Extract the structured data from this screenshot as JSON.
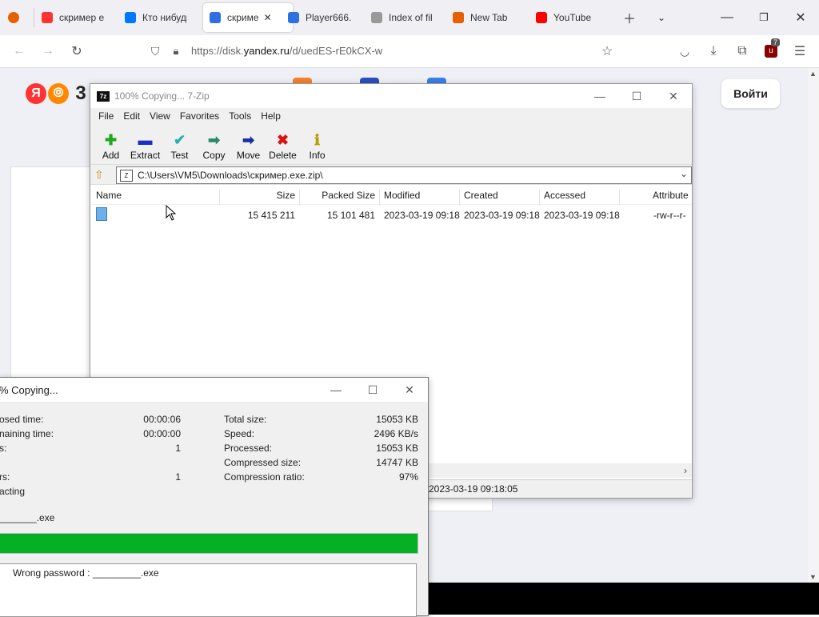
{
  "browser": {
    "tabs": [
      {
        "label": "скример е",
        "icon": "yandex-icon",
        "color": "#f33"
      },
      {
        "label": "Кто нибудь",
        "icon": "vk-icon",
        "color": "#0077ff"
      },
      {
        "label": "скриме",
        "icon": "yandex-disk-icon",
        "color": "#2f6fe0"
      },
      {
        "label": "Player666.",
        "icon": "yandex-disk-icon",
        "color": "#2f6fe0"
      },
      {
        "label": "Index of fil",
        "icon": "document-icon",
        "color": "#999"
      },
      {
        "label": "New Tab",
        "icon": "firefox-icon",
        "color": "#e66000"
      },
      {
        "label": "YouTube",
        "icon": "youtube-icon",
        "color": "#f00"
      }
    ],
    "url_prefix": "https://disk.",
    "url_domain": "yandex.ru",
    "url_path": "/d/uedES-rE0kCX-w",
    "extension_badge": "7"
  },
  "page": {
    "logo_letter": "Я",
    "logo_partial": "3",
    "login_label": "Войти"
  },
  "zip": {
    "title": "100% Copying... 7-Zip",
    "menu": [
      "File",
      "Edit",
      "View",
      "Favorites",
      "Tools",
      "Help"
    ],
    "toolbar": [
      {
        "label": "Add",
        "icon": "plus-icon",
        "glyph": "✚",
        "color": "#1fa81f"
      },
      {
        "label": "Extract",
        "icon": "minus-icon",
        "glyph": "▬",
        "color": "#1a2fbf"
      },
      {
        "label": "Test",
        "icon": "test-checkmark-icon",
        "glyph": "✔",
        "color": "#2bb0b0"
      },
      {
        "label": "Copy",
        "icon": "copy-arrow-icon",
        "glyph": "➡",
        "color": "#2a8a6a"
      },
      {
        "label": "Move",
        "icon": "move-arrow-icon",
        "glyph": "➡",
        "color": "#1a2f9f"
      },
      {
        "label": "Delete",
        "icon": "delete-x-icon",
        "glyph": "✖",
        "color": "#d11"
      },
      {
        "label": "Info",
        "icon": "info-icon",
        "glyph": "ℹ",
        "color": "#b8a000"
      }
    ],
    "path": "C:\\Users\\VM5\\Downloads\\скример.exe.zip\\",
    "columns": [
      "Name",
      "Size",
      "Packed Size",
      "Modified",
      "Created",
      "Accessed",
      "Attribute"
    ],
    "rows": [
      {
        "name": "",
        "size": "15 415 211",
        "packed": "15 101 481",
        "modified": "2023-03-19 09:18",
        "created": "2023-03-19 09:18",
        "accessed": "2023-03-19 09:18",
        "attr": "-rw-r--r-"
      }
    ],
    "status_time": "2023-03-19 09:18:05"
  },
  "progress": {
    "title": "% Copying...",
    "left": [
      {
        "label": "osed time:",
        "value": "00:00:06"
      },
      {
        "label": "naining time:",
        "value": "00:00:00"
      },
      {
        "label": "s:",
        "value": "1"
      },
      {
        "label": "",
        "value": ""
      },
      {
        "label": "rs:",
        "value": "1"
      }
    ],
    "right": [
      {
        "label": "Total size:",
        "value": "15053 KB"
      },
      {
        "label": "Speed:",
        "value": "2496 KB/s"
      },
      {
        "label": "Processed:",
        "value": "15053 KB"
      },
      {
        "label": "Compressed size:",
        "value": "14747 KB"
      },
      {
        "label": "Compression ratio:",
        "value": "97%"
      }
    ],
    "action": "acting",
    "filename": "_______.exe",
    "progress_fraction": 1.0,
    "error_message": "Wrong password : _________.exe"
  }
}
